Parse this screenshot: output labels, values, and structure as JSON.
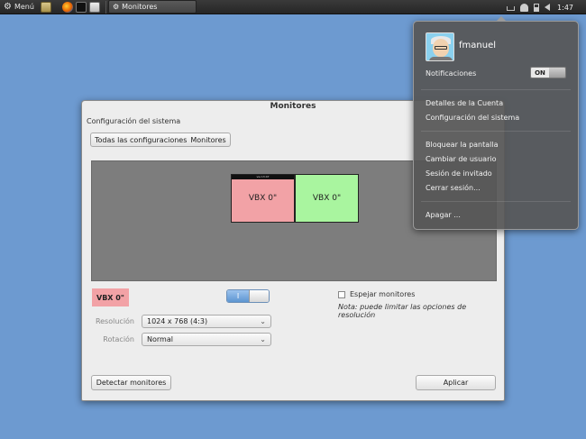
{
  "panel": {
    "menu_label": "Menú",
    "task_label": "Monitores",
    "clock": "1:47"
  },
  "window": {
    "title": "Monitores",
    "crumb_label": "Configuración del sistema",
    "crumbs": [
      "Todas las configuraciones",
      "Monitores"
    ],
    "monitor_top_label": "vie 13:47",
    "monitors": [
      "VBX 0\"",
      "VBX 0\""
    ],
    "selected_display": "VBX 0\"",
    "power_switch": "I",
    "mirror_label": "Espejar monitores",
    "mirror_checked": false,
    "note": "Nota: puede limitar las opciones de resolución",
    "resolution_label": "Resolución",
    "resolution_value": "1024 x 768 (4:3)",
    "rotation_label": "Rotación",
    "rotation_value": "Normal",
    "detect_button": "Detectar monitores",
    "apply_button": "Aplicar"
  },
  "user_menu": {
    "username": "fmanuel",
    "notifications_label": "Notificaciones",
    "notifications_state": "ON",
    "items": [
      "Detalles de la Cuenta",
      "Configuración del sistema",
      "Bloquear la pantalla",
      "Cambiar de usuario",
      "Sesión de invitado",
      "Cerrar sesión...",
      "Apagar ..."
    ]
  },
  "colors": {
    "desktop": "#6d9ad0",
    "monitor_a": "#f2a2a6",
    "monitor_b": "#a9f59f"
  }
}
